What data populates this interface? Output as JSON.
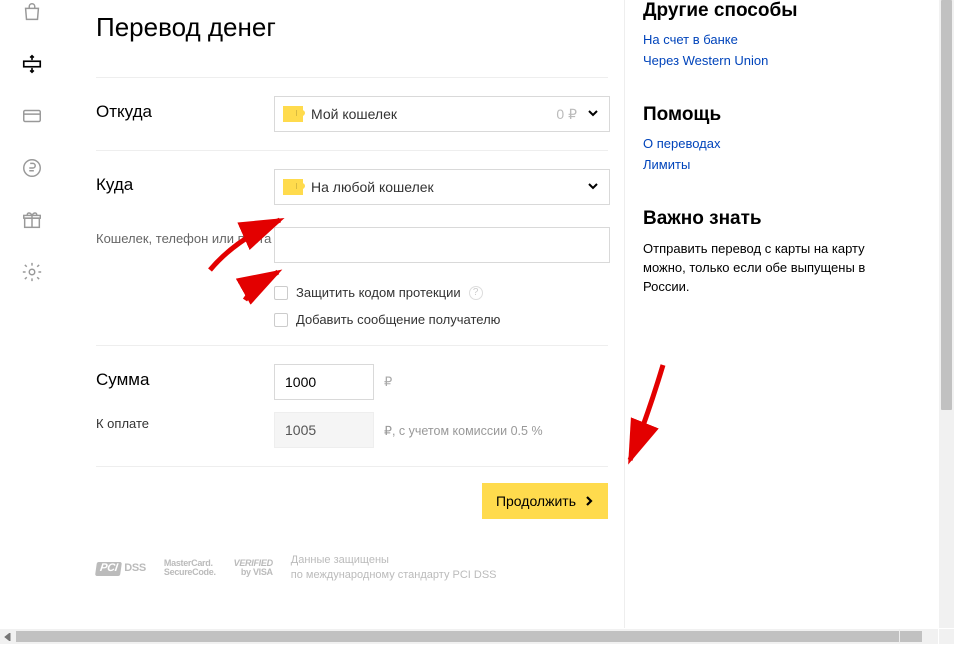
{
  "page": {
    "title": "Перевод денег"
  },
  "form": {
    "from_label": "Откуда",
    "from_value": "Мой кошелек",
    "from_balance": "0 ₽",
    "to_label": "Куда",
    "to_value": "На любой кошелек",
    "recipient_label": "Кошелек, телефон или почта",
    "recipient_value": "",
    "protect_label": "Защитить кодом протекции",
    "attach_msg_label": "Добавить сообщение получателю",
    "amount_label": "Сумма",
    "amount_value": "1000",
    "amount_currency": "₽",
    "to_pay_label": "К оплате",
    "to_pay_value": "1005",
    "to_pay_note": "₽, с учетом комиссии 0.5 %",
    "submit_label": "Продолжить"
  },
  "footer": {
    "badge_pci": "DSS",
    "badge_mc_line1": "MasterCard.",
    "badge_mc_line2": "SecureCode.",
    "badge_visa_line1": "VERIFIED",
    "badge_visa_line2": "by VISA",
    "note_line1": "Данные защищены",
    "note_line2": "по международному стандарту PCI DSS"
  },
  "sidebar": {
    "other_ways_title": "Другие способы",
    "other_ways_links": [
      "На счет в банке",
      "Через Western Union"
    ],
    "help_title": "Помощь",
    "help_links": [
      "О переводах",
      "Лимиты"
    ],
    "important_title": "Важно знать",
    "important_text": "Отправить перевод с карты на карту можно, только если обе выпущены в России."
  },
  "icons": {
    "help_mark": "?"
  }
}
